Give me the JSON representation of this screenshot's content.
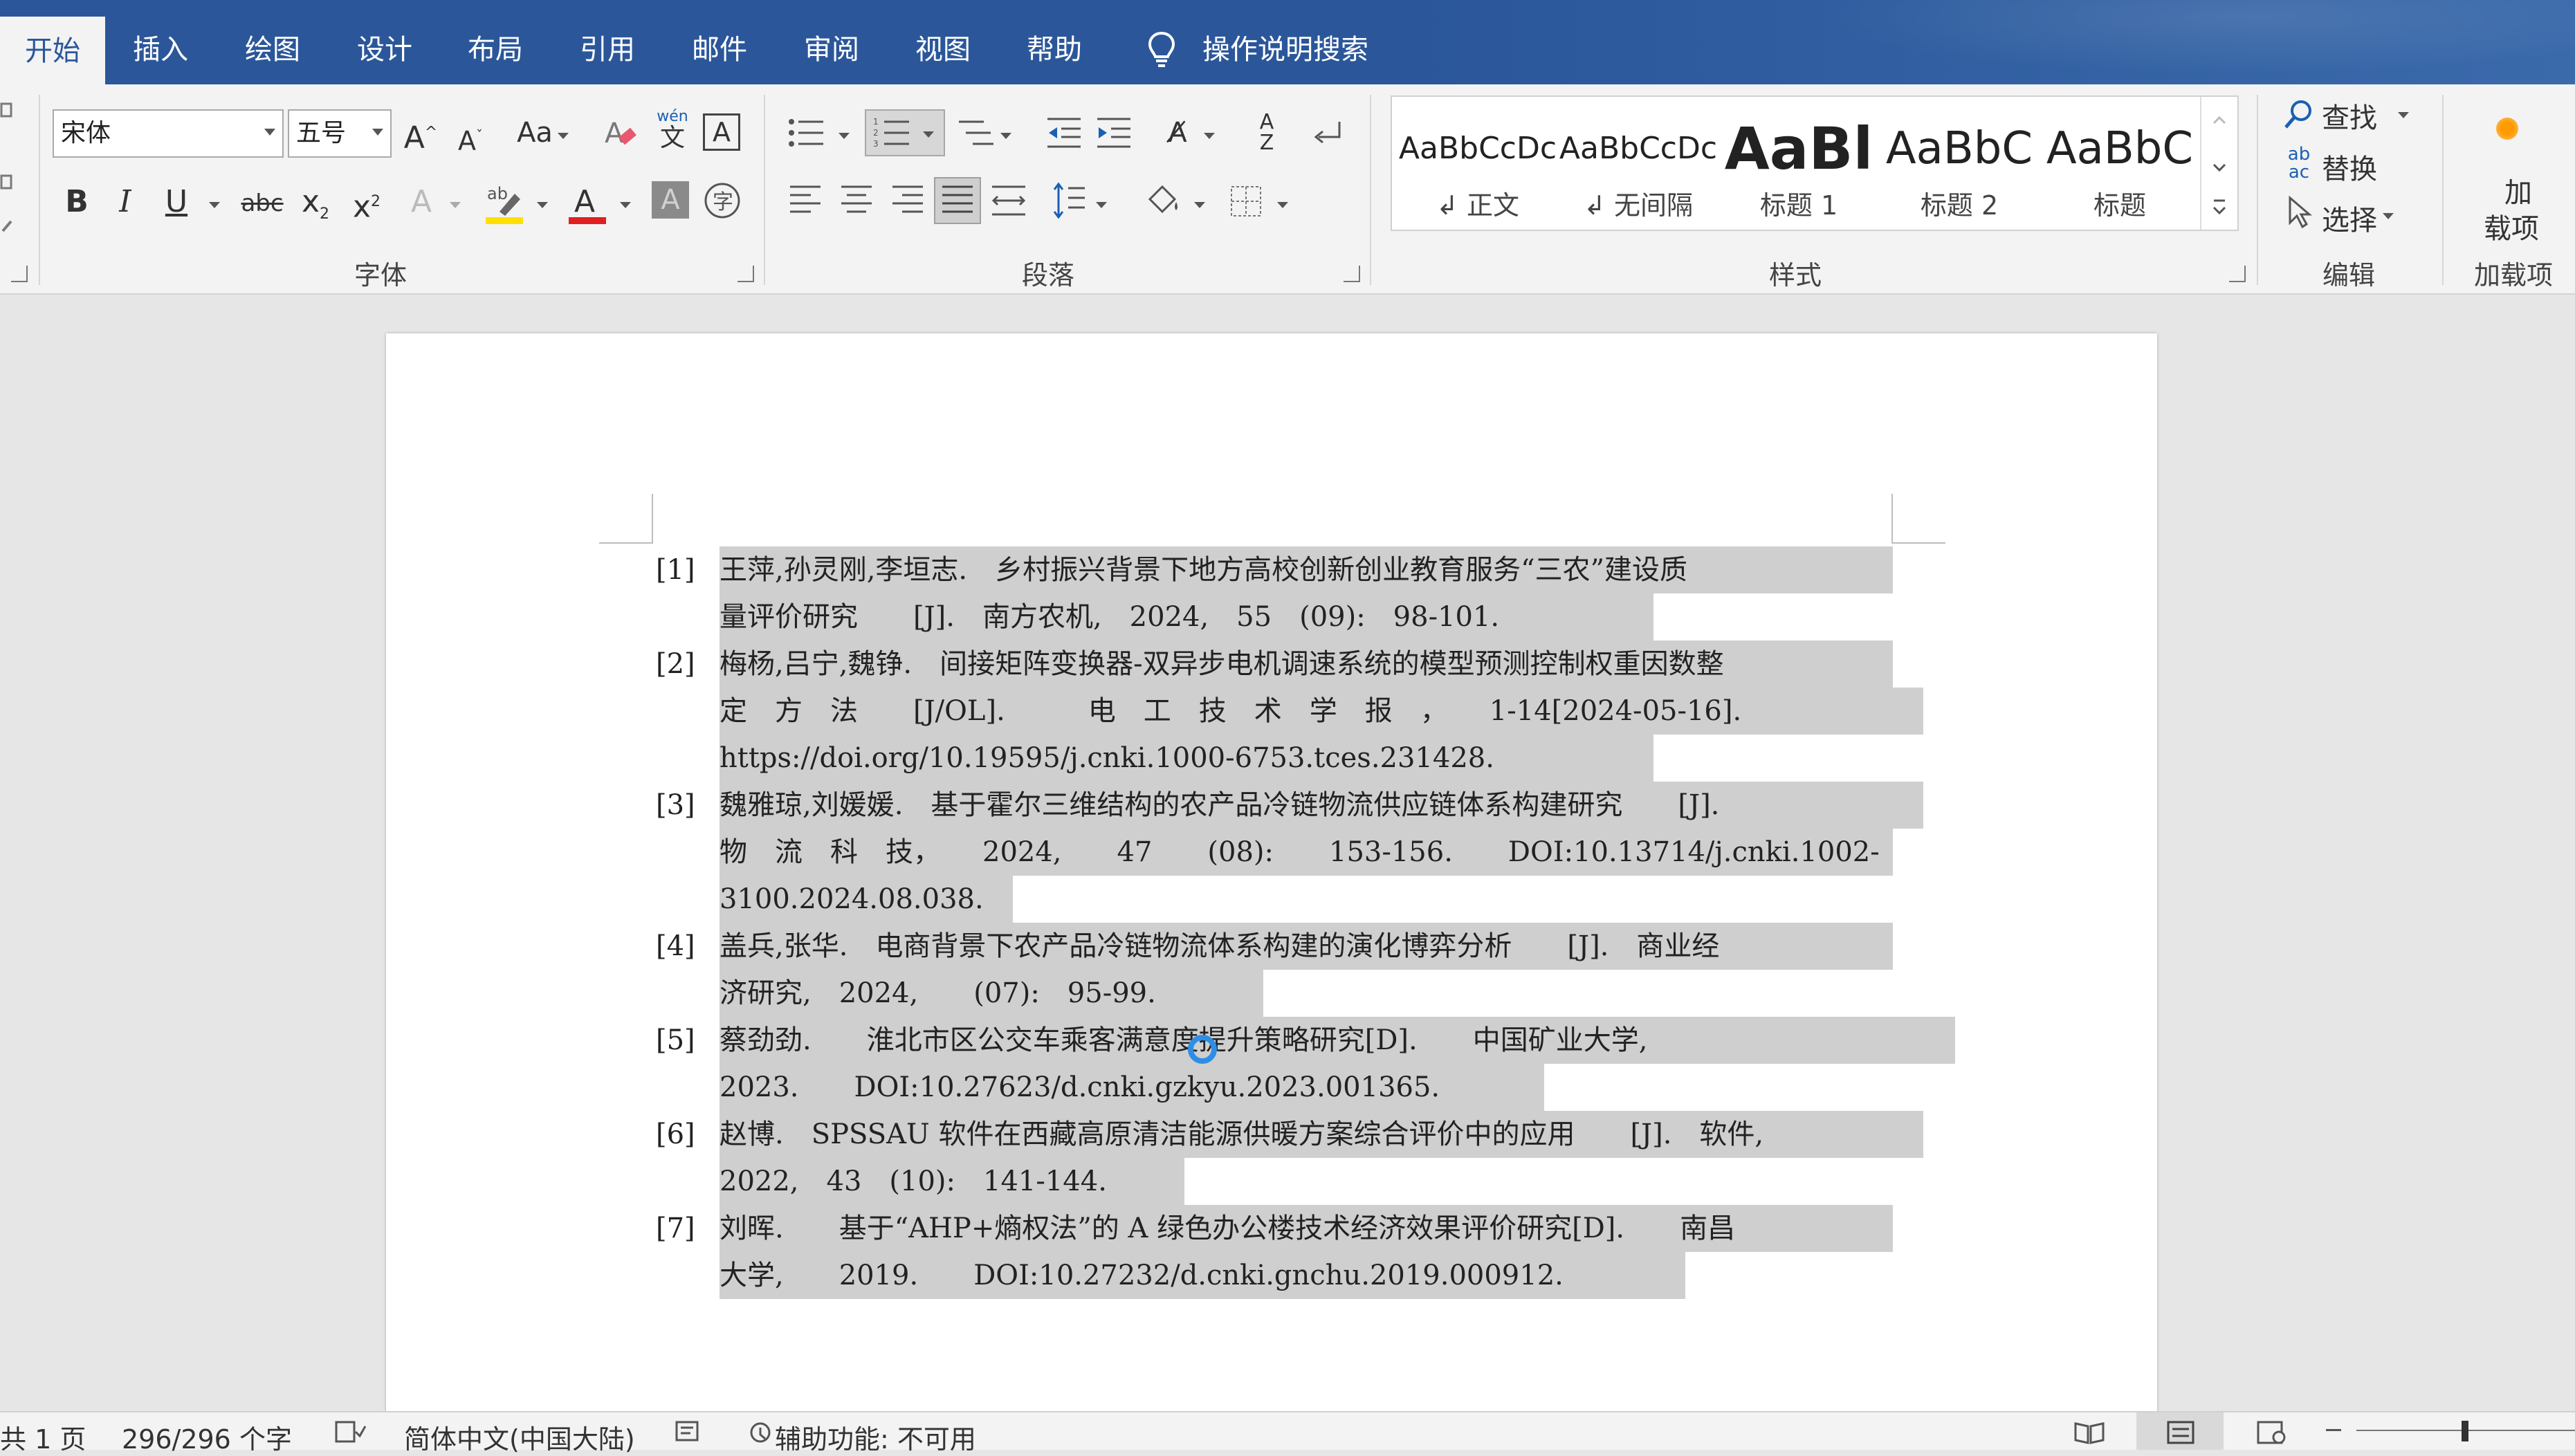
{
  "tabs": [
    {
      "label": "开始",
      "active": true
    },
    {
      "label": "插入"
    },
    {
      "label": "绘图"
    },
    {
      "label": "设计"
    },
    {
      "label": "布局"
    },
    {
      "label": "引用"
    },
    {
      "label": "邮件"
    },
    {
      "label": "审阅"
    },
    {
      "label": "视图"
    },
    {
      "label": "帮助"
    }
  ],
  "search_label": "操作说明搜索",
  "font": {
    "name": "宋体",
    "size": "五号",
    "group_label": "字体"
  },
  "paragraph": {
    "group_label": "段落"
  },
  "styles": {
    "group_label": "样式",
    "items": [
      {
        "sample": "AaBbCcDc",
        "name": "↲ 正文"
      },
      {
        "sample": "AaBbCcDc",
        "name": "↲ 无间隔"
      },
      {
        "sample": "AaBl",
        "name": "标题 1"
      },
      {
        "sample": "AaBbC",
        "name": "标题 2"
      },
      {
        "sample": "AaBbC",
        "name": "标题"
      }
    ]
  },
  "editing": {
    "group_label": "编辑",
    "find": "查找",
    "replace": "替换",
    "select": "选择"
  },
  "addins": {
    "group_label": "加载项",
    "button_line1": "加",
    "button_line2": "载项"
  },
  "references": [
    {
      "num": "[1]",
      "lines": [
        "王萍,孙灵刚,李垣志.　乡村振兴背景下地方高校创新创业教育服务“三农”建设质",
        "量评价研究　　[J].　南方农机,　2024,　55　(09):　98-101."
      ]
    },
    {
      "num": "[2]",
      "lines": [
        "梅杨,吕宁,魏铮.　间接矩阵变换器-双异步电机调速系统的模型预测控制权重因数整",
        "定　方　法　　[J/OL].　　　电　工　技　术　学　报　，　　1-14[2024-05-16].",
        "https://doi.org/10.19595/j.cnki.1000-6753.tces.231428."
      ]
    },
    {
      "num": "[3]",
      "lines": [
        "魏雅琼,刘媛媛.　基于霍尔三维结构的农产品冷链物流供应链体系构建研究　　[J].",
        "物　流　科　技，　　2024,　　47　　(08):　　153-156.　　DOI:10.13714/j.cnki.1002-",
        "3100.2024.08.038."
      ]
    },
    {
      "num": "[4]",
      "lines": [
        "盖兵,张华.　电商背景下农产品冷链物流体系构建的演化博弈分析　　[J].　商业经",
        "济研究,　2024,　　(07):　95-99."
      ]
    },
    {
      "num": "[5]",
      "lines": [
        "蔡劲劲.　　淮北市区公交车乘客满意度提升策略研究[D].　　中国矿业大学,",
        "2023.　　DOI:10.27623/d.cnki.gzkyu.2023.001365."
      ]
    },
    {
      "num": "[6]",
      "lines": [
        "赵博.　SPSSAU 软件在西藏高原清洁能源供暖方案综合评价中的应用　　[J].　软件,",
        "2022,　43　(10):　141-144."
      ]
    },
    {
      "num": "[7]",
      "lines": [
        "刘晖.　　基于“AHP+熵权法”的 A 绿色办公楼技术经济效果评价研究[D].　　南昌",
        "大学,　　2019.　　DOI:10.27232/d.cnki.gnchu.2019.000912."
      ]
    }
  ],
  "status": {
    "page": "共 1 页",
    "words": "296/296 个字",
    "language": "简体中文(中国大陆)",
    "accessibility": "辅助功能: 不可用"
  },
  "colors": {
    "tabbar": "#2b579a",
    "ribbon": "#f3f3f3",
    "selection": "#cfcfcf",
    "font_red": "#e02020",
    "highlight_yellow": "#ffe000",
    "link_blue": "#4472c4"
  }
}
